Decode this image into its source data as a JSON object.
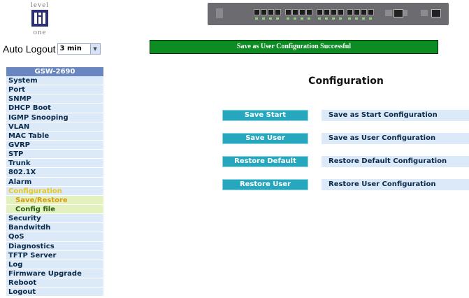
{
  "logo": {
    "top": "level",
    "bottom": "one"
  },
  "auto_logout": {
    "label": "Auto Logout",
    "value": "3 min"
  },
  "status_message": "Save as User Configuration Successful",
  "sidebar": {
    "header": "GSW-2690",
    "items": [
      {
        "label": "System"
      },
      {
        "label": "Port"
      },
      {
        "label": "SNMP"
      },
      {
        "label": "DHCP Boot"
      },
      {
        "label": "IGMP Snooping"
      },
      {
        "label": "VLAN"
      },
      {
        "label": "MAC Table"
      },
      {
        "label": "GVRP"
      },
      {
        "label": "STP"
      },
      {
        "label": "Trunk"
      },
      {
        "label": "802.1X"
      },
      {
        "label": "Alarm"
      },
      {
        "label": "Configuration",
        "active": true
      },
      {
        "label": "Save/Restore",
        "sub": true,
        "active": true
      },
      {
        "label": "Config file",
        "sub": true
      },
      {
        "label": "Security"
      },
      {
        "label": "Bandwitdh"
      },
      {
        "label": "QoS"
      },
      {
        "label": "Diagnostics"
      },
      {
        "label": "TFTP Server"
      },
      {
        "label": "Log"
      },
      {
        "label": "Firmware Upgrade"
      },
      {
        "label": "Reboot"
      },
      {
        "label": "Logout"
      }
    ]
  },
  "main": {
    "title": "Configuration",
    "actions": [
      {
        "button": "Save Start",
        "description": "Save as Start Configuration"
      },
      {
        "button": "Save User",
        "description": "Save as User Configuration"
      },
      {
        "button": "Restore Default",
        "description": "Restore Default Configuration"
      },
      {
        "button": "Restore User",
        "description": "Restore User Configuration"
      }
    ]
  },
  "colors": {
    "banner_bg": "#0e8c24",
    "button_bg": "#26a7bd",
    "sidebar_header_bg": "#6a86c1",
    "sidebar_item_bg": "#dbe9f8",
    "submenu_bg": "#e3f1bf",
    "active_item_text": "#e6c81a"
  }
}
